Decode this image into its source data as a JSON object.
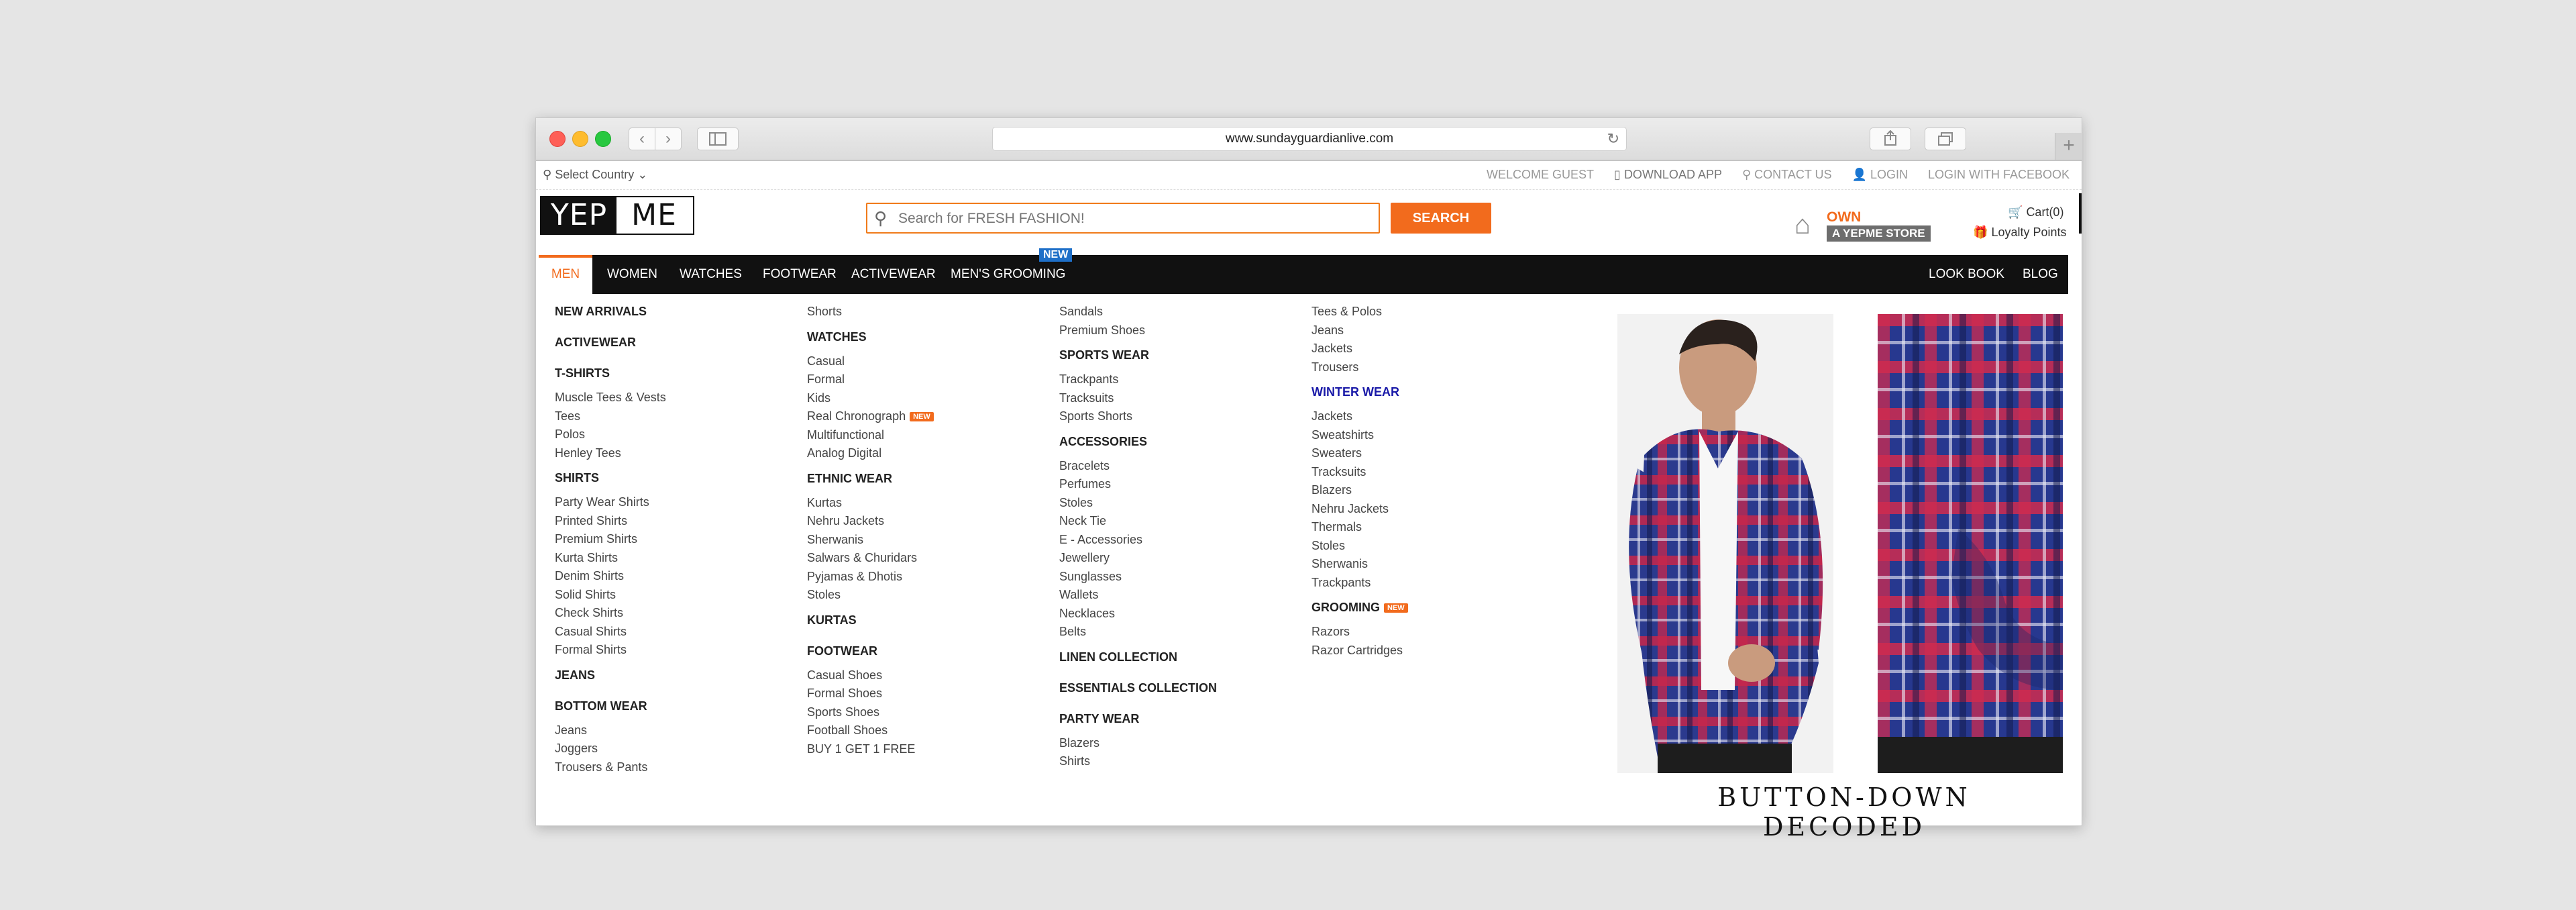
{
  "browser": {
    "url": "www.sundayguardianlive.com"
  },
  "util": {
    "country": "Select Country",
    "welcome": "WELCOME GUEST",
    "download_app": "DOWNLOAD APP",
    "contact_us": "CONTACT US",
    "login": "LOGIN",
    "login_facebook": "LOGIN WITH FACEBOOK"
  },
  "header": {
    "logo_left": "YEP",
    "logo_right": "ME",
    "search_placeholder": "Search for FRESH FASHION!",
    "search_button": "SEARCH",
    "own": "OWN",
    "store": "A YEPME STORE",
    "cart": "Cart(0)",
    "loyalty": "Loyalty Points"
  },
  "nav": {
    "items": [
      "MEN",
      "WOMEN",
      "WATCHES",
      "FOOTWEAR",
      "ACTIVEWEAR",
      "MEN'S GROOMING"
    ],
    "new_tag": "NEW",
    "right_items": [
      "LOOK BOOK",
      "BLOG"
    ]
  },
  "menu": {
    "col1": [
      {
        "t": "h",
        "text": "NEW ARRIVALS"
      },
      {
        "t": "h",
        "text": "ACTIVEWEAR"
      },
      {
        "t": "h",
        "text": "T-SHIRTS"
      },
      {
        "t": "i",
        "text": "Muscle Tees & Vests"
      },
      {
        "t": "i",
        "text": "Tees"
      },
      {
        "t": "i",
        "text": "Polos"
      },
      {
        "t": "i",
        "text": "Henley Tees"
      },
      {
        "t": "h",
        "text": "SHIRTS"
      },
      {
        "t": "i",
        "text": "Party Wear Shirts"
      },
      {
        "t": "i",
        "text": "Printed Shirts"
      },
      {
        "t": "i",
        "text": "Premium Shirts"
      },
      {
        "t": "i",
        "text": "Kurta Shirts"
      },
      {
        "t": "i",
        "text": "Denim Shirts"
      },
      {
        "t": "i",
        "text": "Solid Shirts"
      },
      {
        "t": "i",
        "text": "Check Shirts"
      },
      {
        "t": "i",
        "text": "Casual Shirts"
      },
      {
        "t": "i",
        "text": "Formal Shirts"
      },
      {
        "t": "h",
        "text": "JEANS"
      },
      {
        "t": "h",
        "text": "BOTTOM WEAR"
      },
      {
        "t": "i",
        "text": "Jeans"
      },
      {
        "t": "i",
        "text": "Joggers"
      },
      {
        "t": "i",
        "text": "Trousers & Pants"
      }
    ],
    "col2": [
      {
        "t": "i",
        "text": "Shorts"
      },
      {
        "t": "h",
        "text": "WATCHES"
      },
      {
        "t": "i",
        "text": "Casual"
      },
      {
        "t": "i",
        "text": "Formal"
      },
      {
        "t": "i",
        "text": "Kids"
      },
      {
        "t": "i",
        "text": "Real Chronograph",
        "badge": "NEW"
      },
      {
        "t": "i",
        "text": "Multifunctional"
      },
      {
        "t": "i",
        "text": "Analog Digital"
      },
      {
        "t": "h",
        "text": "ETHNIC WEAR"
      },
      {
        "t": "i",
        "text": "Kurtas"
      },
      {
        "t": "i",
        "text": "Nehru Jackets"
      },
      {
        "t": "i",
        "text": "Sherwanis"
      },
      {
        "t": "i",
        "text": "Salwars & Churidars"
      },
      {
        "t": "i",
        "text": "Pyjamas & Dhotis"
      },
      {
        "t": "i",
        "text": "Stoles"
      },
      {
        "t": "h",
        "text": "KURTAS"
      },
      {
        "t": "h",
        "text": "FOOTWEAR"
      },
      {
        "t": "i",
        "text": "Casual Shoes"
      },
      {
        "t": "i",
        "text": "Formal Shoes"
      },
      {
        "t": "i",
        "text": "Sports Shoes"
      },
      {
        "t": "i",
        "text": "Football Shoes"
      },
      {
        "t": "i",
        "text": "BUY 1 GET 1 FREE"
      }
    ],
    "col3": [
      {
        "t": "i",
        "text": "Sandals"
      },
      {
        "t": "i",
        "text": "Premium Shoes"
      },
      {
        "t": "h",
        "text": "SPORTS WEAR"
      },
      {
        "t": "i",
        "text": "Trackpants"
      },
      {
        "t": "i",
        "text": "Tracksuits"
      },
      {
        "t": "i",
        "text": "Sports Shorts"
      },
      {
        "t": "h",
        "text": "ACCESSORIES"
      },
      {
        "t": "i",
        "text": "Bracelets"
      },
      {
        "t": "i",
        "text": "Perfumes"
      },
      {
        "t": "i",
        "text": "Stoles"
      },
      {
        "t": "i",
        "text": "Neck Tie"
      },
      {
        "t": "i",
        "text": "E - Accessories"
      },
      {
        "t": "i",
        "text": "Jewellery"
      },
      {
        "t": "i",
        "text": "Sunglasses"
      },
      {
        "t": "i",
        "text": "Wallets"
      },
      {
        "t": "i",
        "text": "Necklaces"
      },
      {
        "t": "i",
        "text": "Belts"
      },
      {
        "t": "h",
        "text": "LINEN COLLECTION"
      },
      {
        "t": "h",
        "text": "ESSENTIALS COLLECTION"
      },
      {
        "t": "h",
        "text": "PARTY WEAR"
      },
      {
        "t": "i",
        "text": "Blazers"
      },
      {
        "t": "i",
        "text": "Shirts"
      }
    ],
    "col4": [
      {
        "t": "i",
        "text": "Tees & Polos"
      },
      {
        "t": "i",
        "text": "Jeans"
      },
      {
        "t": "i",
        "text": "Jackets"
      },
      {
        "t": "i",
        "text": "Trousers"
      },
      {
        "t": "h",
        "text": "WINTER WEAR",
        "blue": true
      },
      {
        "t": "i",
        "text": "Jackets"
      },
      {
        "t": "i",
        "text": "Sweatshirts"
      },
      {
        "t": "i",
        "text": "Sweaters"
      },
      {
        "t": "i",
        "text": "Tracksuits"
      },
      {
        "t": "i",
        "text": "Blazers"
      },
      {
        "t": "i",
        "text": "Nehru Jackets"
      },
      {
        "t": "i",
        "text": "Thermals"
      },
      {
        "t": "i",
        "text": "Stoles"
      },
      {
        "t": "i",
        "text": "Sherwanis"
      },
      {
        "t": "i",
        "text": "Trackpants"
      },
      {
        "t": "h",
        "text": "GROOMING",
        "badge": "NEW"
      },
      {
        "t": "i",
        "text": "Razors"
      },
      {
        "t": "i",
        "text": "Razor Cartridges"
      }
    ]
  },
  "promo": {
    "title": "BUTTON-DOWN DECODED"
  }
}
